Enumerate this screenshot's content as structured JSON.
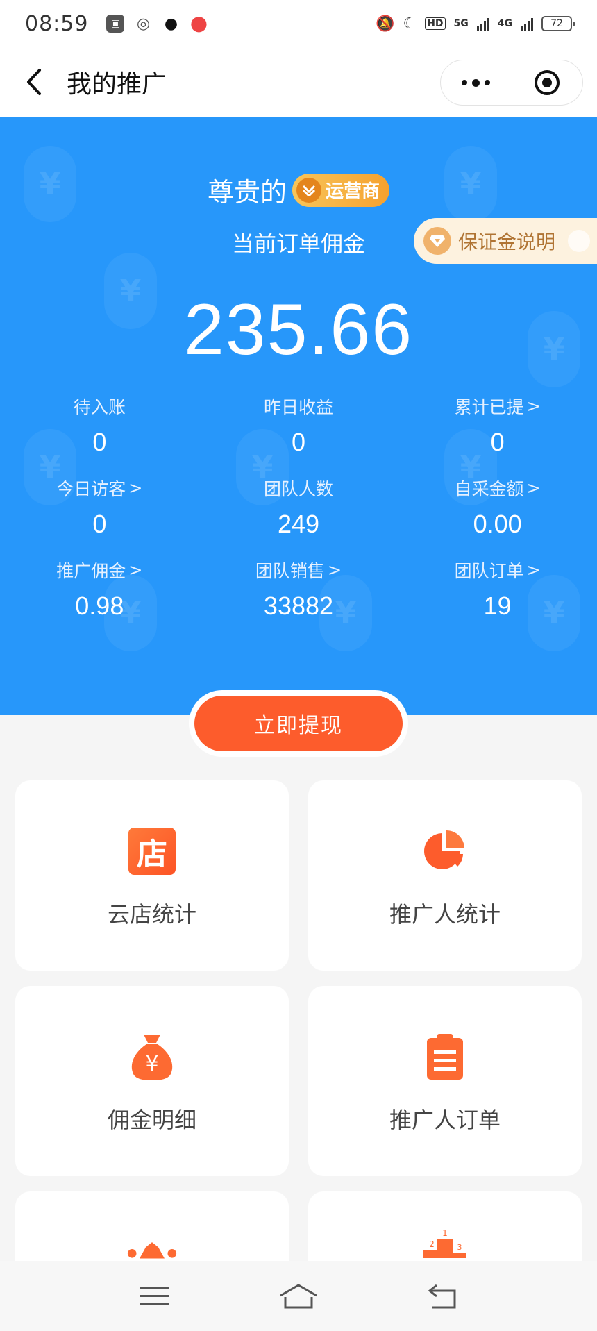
{
  "status_bar": {
    "time": "08:59",
    "network_1": "5G",
    "network_2": "4G",
    "hd": "HD",
    "battery": "72"
  },
  "nav": {
    "title": "我的推广"
  },
  "hero": {
    "title_prefix": "尊贵的",
    "badge": "运营商",
    "subtitle": "当前订单佣金",
    "deposit_label": "保证金说明",
    "amount": "235.66",
    "stats": [
      {
        "label": "待入账",
        "value": "0",
        "arrow": ""
      },
      {
        "label": "昨日收益",
        "value": "0",
        "arrow": ""
      },
      {
        "label": "累计已提",
        "value": "0",
        "arrow": ">"
      },
      {
        "label": "今日访客",
        "value": "0",
        "arrow": ">"
      },
      {
        "label": "团队人数",
        "value": "249",
        "arrow": ""
      },
      {
        "label": "自采金额",
        "value": "0.00",
        "arrow": ">"
      },
      {
        "label": "推广佣金",
        "value": "0.98",
        "arrow": ">"
      },
      {
        "label": "团队销售",
        "value": "33882",
        "arrow": ">"
      },
      {
        "label": "团队订单",
        "value": "19",
        "arrow": ">"
      }
    ]
  },
  "withdraw": {
    "label": "立即提现"
  },
  "cards": [
    {
      "label": "云店统计",
      "icon": "store-icon",
      "icon_text": "店"
    },
    {
      "label": "推广人统计",
      "icon": "pie-chart-icon"
    },
    {
      "label": "佣金明细",
      "icon": "money-bag-icon",
      "icon_text": "¥"
    },
    {
      "label": "推广人订单",
      "icon": "clipboard-icon"
    },
    {
      "label": "",
      "icon": "crown-icon"
    },
    {
      "label": "",
      "icon": "podium-icon",
      "icon_text": [
        "1",
        "2",
        "3"
      ]
    }
  ],
  "colors": {
    "hero_blue": "#2797fa",
    "accent_orange": "#fd5c2c",
    "card_bg": "#ffffff",
    "page_bg": "#f5f5f5"
  }
}
